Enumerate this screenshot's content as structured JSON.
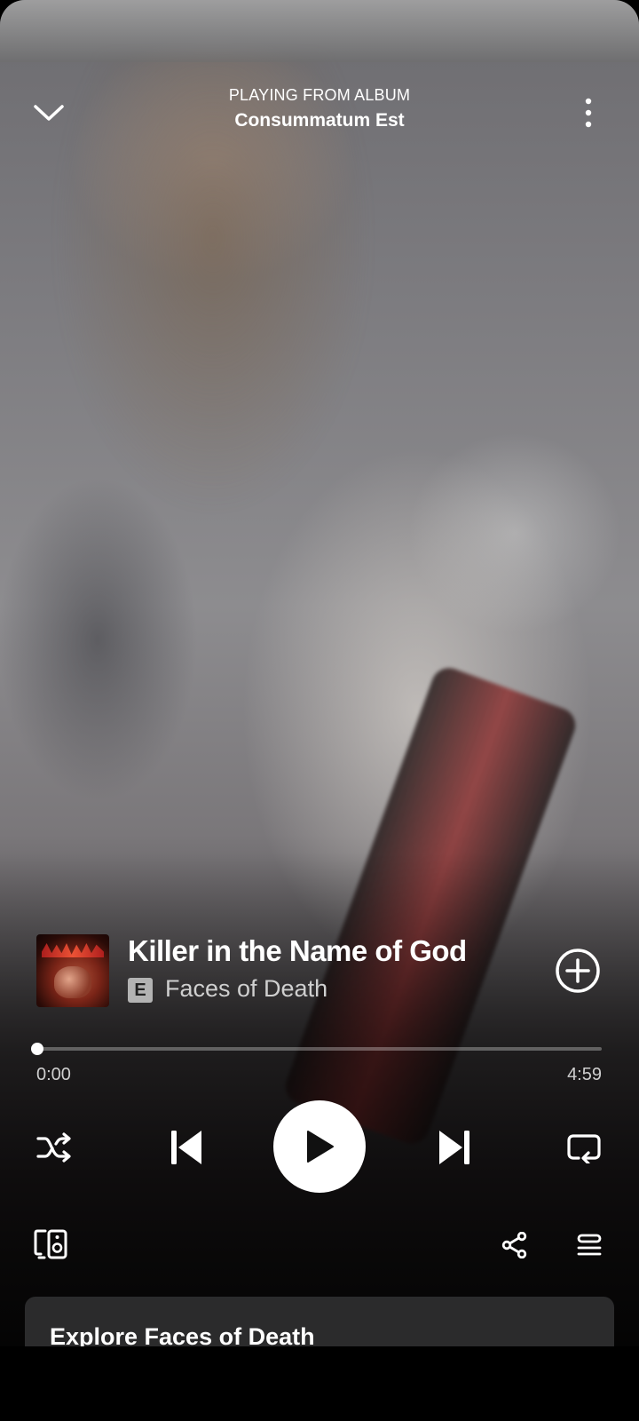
{
  "header": {
    "subtitle": "PLAYING FROM ALBUM",
    "title": "Consummatum Est",
    "collapse_icon": "chevron-down-icon",
    "menu_icon": "more-vertical-icon"
  },
  "track": {
    "title": "Killer in the Name of God",
    "explicit_badge": "E",
    "artist": "Faces of Death",
    "add_icon": "add-circle-icon"
  },
  "progress": {
    "current": "0:00",
    "total": "4:59",
    "fraction": 0.0
  },
  "controls": {
    "shuffle_icon": "shuffle-icon",
    "previous_icon": "skip-previous-icon",
    "play_icon": "play-icon",
    "next_icon": "skip-next-icon",
    "repeat_icon": "repeat-icon"
  },
  "actions": {
    "devices_icon": "connect-devices-icon",
    "share_icon": "share-icon",
    "queue_icon": "queue-icon"
  },
  "explore": {
    "title": "Explore Faces of Death"
  },
  "colors": {
    "accent": "#ffffff",
    "secondary_text": "#cfcfcf",
    "card_bg": "#2b2b2c"
  }
}
